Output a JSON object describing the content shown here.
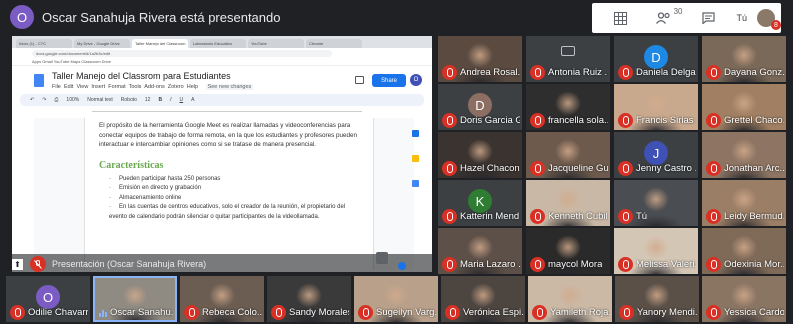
{
  "header": {
    "avatar_letter": "O",
    "title": "Oscar Sanahuja Rivera está presentando",
    "participant_count": "30",
    "self_label": "Tú",
    "notification_badge": "8"
  },
  "presentation": {
    "browser_tabs": [
      "Inicio (1) - CTC",
      "My Drive - Google Drive",
      "Taller Manejo del Classroom",
      "Laboratorio Educativo",
      "YouTube",
      "Chrome"
    ],
    "url": "docs.google.com/document/d/1a2b3c/edit",
    "bookmarks": "Apps  Gmail  YouTube  Maps  Classroom  Drive",
    "doc_title": "Taller Manejo del Classrom para  Estudiantes",
    "menu": [
      "File",
      "Edit",
      "View",
      "Insert",
      "Format",
      "Tools",
      "Add-ons",
      "Zotero",
      "Help"
    ],
    "save_status": "See new changes",
    "share_label": "Share",
    "doc_avatar": "O",
    "toolbar": {
      "zoom": "100%",
      "style": "Normal text",
      "font": "Roboto",
      "size": "12"
    },
    "intro": "El propósito de la herramienta Google Meet es realizar llamadas y videoconferencias para conectar equipos de trabajo de forma remota, en la que los estudiantes y profesores pueden interactuar e intercambiar opiniones como si se tratase de manera presencial.",
    "heading": "Características",
    "bullets": [
      "Pueden participar hasta 250 personas",
      "Emisión en directo y grabación",
      "Almacenamiento online",
      "En las cuentas de centros educativos, solo el creador de la reunión, el propietario del evento de calendario podrán silenciar o quitar participantes de la videollamada."
    ],
    "label": "Presentación (Oscar Sanahuja Rivera)"
  },
  "participants": [
    {
      "name": "Andrea Rosal...",
      "kind": "photo",
      "bg": "#5a4a40"
    },
    {
      "name": "Antonia Ruiz ...",
      "kind": "camoff",
      "bg": "#3c4043"
    },
    {
      "name": "Daniela Delga...",
      "kind": "letter",
      "letter": "D",
      "bg": "#3c4043",
      "avatar_color": "#1e88e5"
    },
    {
      "name": "Dayana Gonz...",
      "kind": "photo",
      "bg": "#7a6858"
    },
    {
      "name": "Doris Garcia G...",
      "kind": "letter",
      "letter": "D",
      "bg": "#3c4043",
      "avatar_color": "#8d6e63"
    },
    {
      "name": "francella sola...",
      "kind": "photo",
      "bg": "#2e2e2e"
    },
    {
      "name": "Francis Sirias ...",
      "kind": "photo",
      "bg": "#c8a98e"
    },
    {
      "name": "Grettel Chaco...",
      "kind": "photo",
      "bg": "#a07f62"
    },
    {
      "name": "Hazel Chacon",
      "kind": "photo",
      "bg": "#3a3330"
    },
    {
      "name": "Jacqueline Gu...",
      "kind": "photo",
      "bg": "#6d5a4c"
    },
    {
      "name": "Jenny Castro ...",
      "kind": "letter",
      "letter": "J",
      "bg": "#3c4043",
      "avatar_color": "#3f51b5"
    },
    {
      "name": "Jonathan Arc...",
      "kind": "photo",
      "bg": "#8e7563"
    },
    {
      "name": "Katterin Mend...",
      "kind": "letter",
      "letter": "K",
      "bg": "#3c4043",
      "avatar_color": "#2e7d32"
    },
    {
      "name": "Kenneth Cubil...",
      "kind": "photo",
      "bg": "#c9b8a5"
    },
    {
      "name": "Tú",
      "kind": "photo",
      "bg": "#4a4d52"
    },
    {
      "name": "Leidy Bermud...",
      "kind": "photo",
      "bg": "#9b7e66"
    },
    {
      "name": "Maria Lazaro ...",
      "kind": "photo",
      "bg": "#5d5048"
    },
    {
      "name": "maycol Mora",
      "kind": "photo",
      "bg": "#2a2a2a"
    },
    {
      "name": "Melissa Valeri...",
      "kind": "photo",
      "bg": "#d4c6b5"
    },
    {
      "name": "Odexinia Mor...",
      "kind": "photo",
      "bg": "#7f6a58"
    }
  ],
  "bottom_row": [
    {
      "name": "Odilie Chavarr...",
      "kind": "letter",
      "letter": "O",
      "bg": "#3c4043",
      "avatar_color": "#7b5cc4"
    },
    {
      "name": "Oscar Sanahu...",
      "kind": "photo",
      "bg": "#8f8a82",
      "speaking": true
    },
    {
      "name": "Rebeca Colo...",
      "kind": "photo",
      "bg": "#6b5d52"
    },
    {
      "name": "Sandy Morales",
      "kind": "photo",
      "bg": "#3a3a3a"
    },
    {
      "name": "Sugeilyn Varg...",
      "kind": "photo",
      "bg": "#b8a08a"
    },
    {
      "name": "Verónica Espi...",
      "kind": "photo",
      "bg": "#4d4540"
    },
    {
      "name": "Yamileth Roja...",
      "kind": "photo",
      "bg": "#cbb9a6"
    },
    {
      "name": "Yanory Mendi...",
      "kind": "photo",
      "bg": "#5a5048"
    },
    {
      "name": "Yessica Cardo...",
      "kind": "photo",
      "bg": "#8a7563"
    }
  ]
}
